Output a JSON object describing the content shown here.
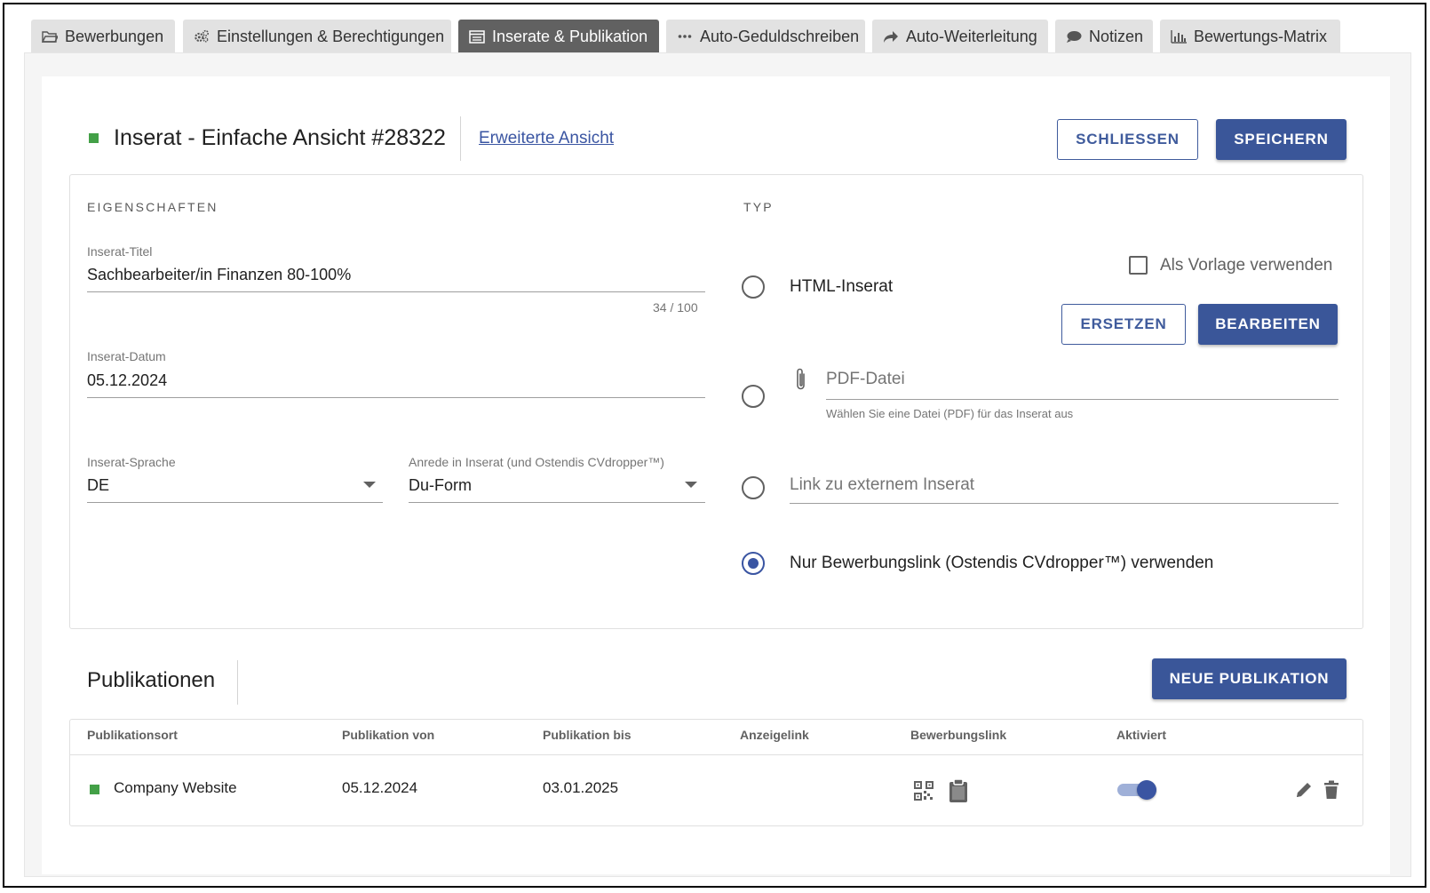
{
  "tabs": [
    {
      "label": "Bewerbungen",
      "icon": "folder-open-icon",
      "active": false
    },
    {
      "label": "Einstellungen & Berechtigungen",
      "icon": "gears-icon",
      "active": false
    },
    {
      "label": "Inserate & Publikation",
      "icon": "list-alt-icon",
      "active": true
    },
    {
      "label": "Auto-Geduldschreiben",
      "icon": "ellipsis-icon",
      "active": false
    },
    {
      "label": "Auto-Weiterleitung",
      "icon": "share-arrow-icon",
      "active": false
    },
    {
      "label": "Notizen",
      "icon": "comment-icon",
      "active": false
    },
    {
      "label": "Bewertungs-Matrix",
      "icon": "bar-chart-icon",
      "active": false
    }
  ],
  "header": {
    "title": "Inserat - Einfache Ansicht #28322",
    "advanced_link": "Erweiterte Ansicht",
    "close_label": "SCHLIESSEN",
    "save_label": "SPEICHERN",
    "status_color": "#43a047"
  },
  "properties": {
    "section_label": "EIGENSCHAFTEN",
    "title_field": {
      "label": "Inserat-Titel",
      "value": "Sachbearbeiter/in Finanzen 80-100%",
      "counter": "34 / 100"
    },
    "date_field": {
      "label": "Inserat-Datum",
      "value": "05.12.2024"
    },
    "language_field": {
      "label": "Inserat-Sprache",
      "value": "DE"
    },
    "salutation_field": {
      "label": "Anrede in Inserat (und Ostendis CVdropper™)",
      "value": "Du-Form"
    }
  },
  "type": {
    "section_label": "TYP",
    "template_checkbox_label": "Als Vorlage verwenden",
    "template_checked": false,
    "options": [
      {
        "label": "HTML-Inserat",
        "checked": false
      },
      {
        "label": "PDF-Datei",
        "hint": "Wählen Sie eine Datei (PDF) für das Inserat aus",
        "checked": false
      },
      {
        "label": "Link zu externem Inserat",
        "checked": false
      },
      {
        "label": "Nur Bewerbungslink (Ostendis CVdropper™) verwenden",
        "checked": true
      }
    ],
    "replace_label": "ERSETZEN",
    "edit_label": "BEARBEITEN"
  },
  "publications": {
    "title": "Publikationen",
    "new_label": "NEUE PUBLIKATION",
    "columns": [
      "Publikationsort",
      "Publikation von",
      "Publikation bis",
      "Anzeigelink",
      "Bewerbungslink",
      "Aktiviert"
    ],
    "rows": [
      {
        "place": "Company Website",
        "from": "05.12.2024",
        "to": "03.01.2025",
        "ad_link": "",
        "active": true,
        "status_color": "#43a047"
      }
    ]
  },
  "colors": {
    "primary": "#3a5699",
    "active_tab": "#616161",
    "status": "#43a047"
  }
}
